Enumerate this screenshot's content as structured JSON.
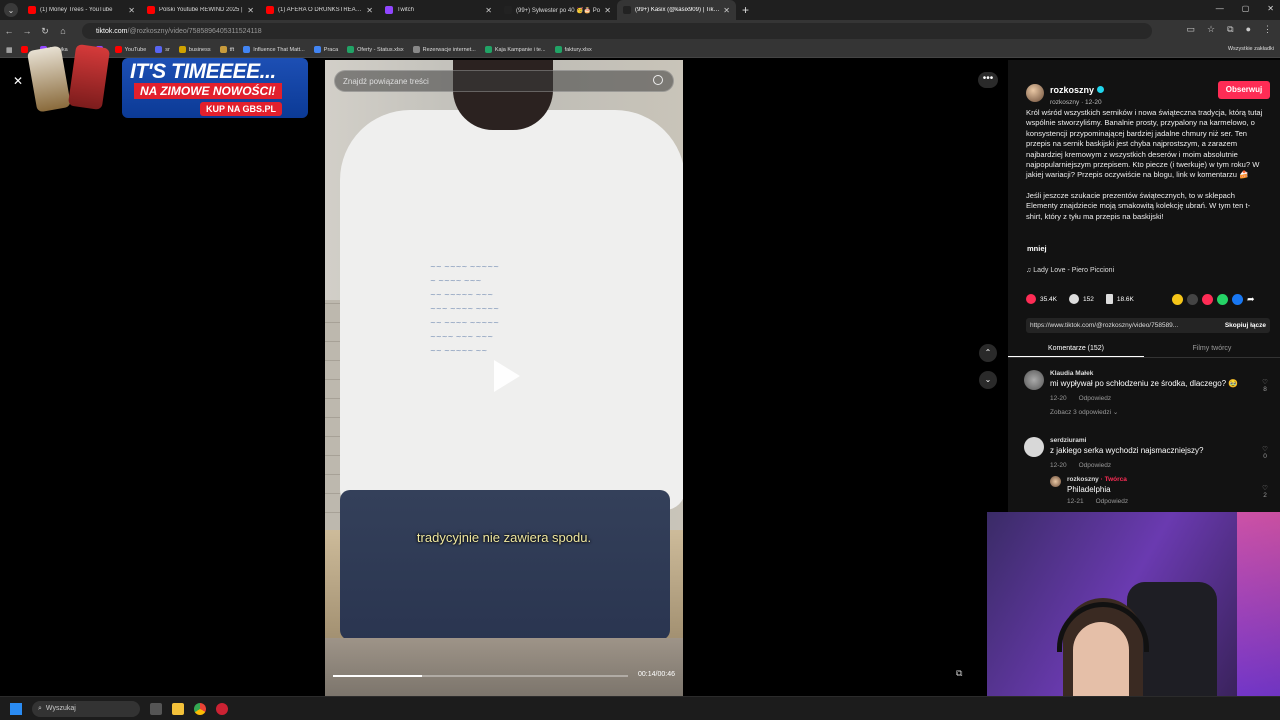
{
  "browser": {
    "tabs": [
      {
        "title": "(1) Money Trees - YouTube",
        "color": "#ff0000",
        "active": false
      },
      {
        "title": "Polski Youtube REWIND 2025 |",
        "color": "#ff0000",
        "active": false
      },
      {
        "title": "(1) AFERA O DRUNKSTREAM B",
        "color": "#ff0000",
        "active": false
      },
      {
        "title": "Twitch",
        "color": "#9146ff",
        "active": false
      },
      {
        "title": "(99+) Sylwester po 40 🥳🎂 Po",
        "color": "#222222",
        "active": false
      },
      {
        "title": "(99+) Kasix (@kasix909) | TikTok",
        "color": "#222222",
        "active": true
      }
    ],
    "new_tab": "+",
    "url_host": "tiktok.com",
    "url_path": "/@rozkoszny/video/7585896405311524118",
    "bookmarks": [
      {
        "label": "",
        "color": "#ff0000"
      },
      {
        "label": "Kolejka",
        "color": "#9146ff"
      },
      {
        "label": "",
        "color": "#53fc18"
      },
      {
        "label": "",
        "color": "#9146ff"
      },
      {
        "label": "YouTube",
        "color": "#ff0000"
      },
      {
        "label": "sr",
        "color": "#5865f2"
      },
      {
        "label": "business",
        "color": "#cfa200"
      },
      {
        "label": "tft",
        "color": "#c89b3c"
      },
      {
        "label": "Influence That Matt...",
        "color": "#4285f4"
      },
      {
        "label": "Praca",
        "color": "#4285f4"
      },
      {
        "label": "Oferty - Status.xlsx",
        "color": "#21a366"
      },
      {
        "label": "Rezerwacje internet...",
        "color": "#888888"
      },
      {
        "label": "Kaja Kampanie i te...",
        "color": "#21a366"
      },
      {
        "label": "faktury.xlsx",
        "color": "#21a366"
      }
    ],
    "all_bookmarks": "Wszystkie zakładki"
  },
  "ad": {
    "line1": "IT'S TIMEEEE...",
    "line2": "NA ZIMOWE NOWOŚCI!",
    "cta": "KUP NA GBS.PL"
  },
  "video": {
    "search_placeholder": "Znajdź powiązane treści",
    "subtitle": "tradycyjnie nie zawiera spodu.",
    "time": "00:14/00:46",
    "progress": 0.3
  },
  "post": {
    "author": "rozkoszny",
    "author_sub": "rozkoszny · 12-20",
    "follow": "Obserwuj",
    "desc_p1": "Król wśród wszystkich serników i nowa świąteczna tradycja, którą tutaj wspólnie stworzyliśmy. Banalnie prosty, przypalony na karmelowo, o konsystencji przypominającej bardziej jadalne chmury niż ser. Ten przepis na sernik baskijski jest chyba najprostszym, a zarazem najbardziej kremowym z wszystkich deserów i moim absolutnie najpopularniejszym przepisem. Kto piecze (i twerkuje) w tym roku? W jakiej wariacji? Przepis oczywiście na blogu, link w komentarzu 🍰",
    "desc_p2": "Jeśli jeszcze szukacie prezentów świątecznych, to w sklepach Elementy znajdziecie moją smakowitą kolekcję ubrań. W tym ten t-shirt, który z tyłu ma przepis na baskijski!",
    "less": "mniej",
    "music": "♫  Lady Love - Piero Piccioni",
    "likes": "35.4K",
    "comments_count": "152",
    "saves": "18.6K",
    "link": "https://www.tiktok.com/@rozkoszny/video/758589...",
    "copy": "Skopiuj łącze",
    "tab_comments": "Komentarze (152)",
    "tab_creator": "Filmy twórcy"
  },
  "comments": [
    {
      "name": "Klaudia Małek",
      "text": "mi wypływał po schłodzeniu ze środka, dlaczego? 🥹",
      "date": "12-20",
      "reply": "Odpowiedz",
      "likes": "8",
      "more": "Zobacz 3 odpowiedzi ⌄"
    },
    {
      "name": "serdziurami",
      "text": "z jakiego serka wychodzi najsmaczniejszy?",
      "date": "12-20",
      "reply": "Odpowiedz",
      "likes": "0"
    },
    {
      "name": "rozkoszny",
      "badge": "· Twórca",
      "text": "Philadelphia",
      "date": "12-21",
      "reply": "Odpowiedz",
      "likes": "2"
    }
  ],
  "taskbar": {
    "search": "Wyszukaj"
  }
}
